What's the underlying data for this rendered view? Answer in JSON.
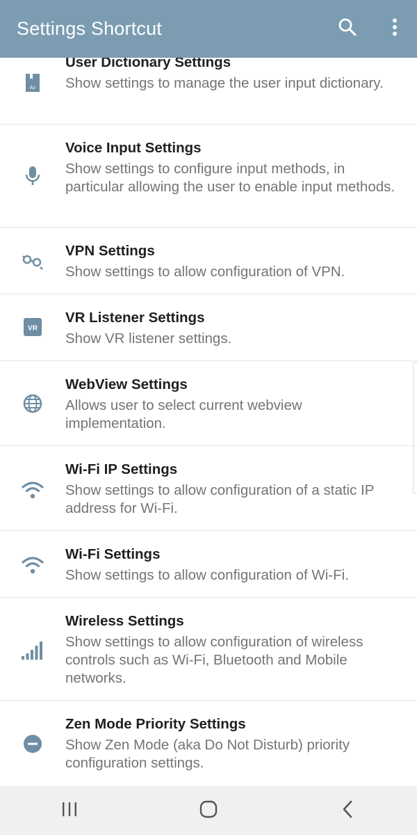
{
  "appbar": {
    "title": "Settings Shortcut",
    "search_icon": "search-icon",
    "menu_icon": "more-vert-icon"
  },
  "colors": {
    "appbar": "#7b9cb1",
    "icon": "#6f8ea3",
    "title_text": "#1f1f1f",
    "desc_text": "#747474"
  },
  "items": [
    {
      "title": "User Dictionary Settings",
      "desc": "Show settings to manage the user input dictionary.",
      "icon": "dictionary-icon"
    },
    {
      "title": "Voice Input Settings",
      "desc": "Show settings to configure input methods, in particular allowing the user to enable input methods.",
      "icon": "microphone-icon"
    },
    {
      "title": "VPN Settings",
      "desc": "Show settings to allow configuration of VPN.",
      "icon": "vpn-key-icon"
    },
    {
      "title": "VR Listener Settings",
      "desc": "Show VR listener settings.",
      "icon": "vr-icon",
      "icon_text": "VR"
    },
    {
      "title": "WebView Settings",
      "desc": "Allows user to select current webview implementation.",
      "icon": "globe-icon"
    },
    {
      "title": "Wi-Fi IP Settings",
      "desc": "Show settings to allow configuration of a static IP address for Wi-Fi.",
      "icon": "wifi-icon"
    },
    {
      "title": "Wi-Fi Settings",
      "desc": "Show settings to allow configuration of Wi-Fi.",
      "icon": "wifi-icon"
    },
    {
      "title": "Wireless Settings",
      "desc": "Show settings to allow configuration of wireless controls such as Wi-Fi, Bluetooth and Mobile networks.",
      "icon": "signal-bars-icon"
    },
    {
      "title": "Zen Mode Priority Settings",
      "desc": "Show Zen Mode (aka Do Not Disturb) priority configuration settings.",
      "icon": "do-not-disturb-icon"
    }
  ],
  "navbar": {
    "recents_icon": "recent-apps-icon",
    "home_icon": "home-icon",
    "back_icon": "back-icon"
  }
}
